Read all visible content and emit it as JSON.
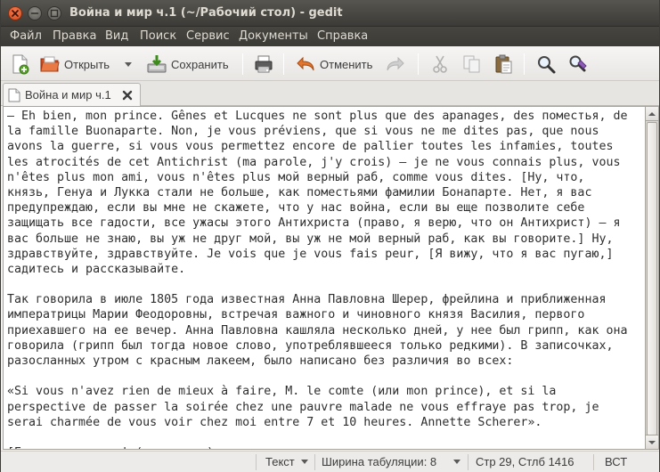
{
  "window": {
    "title": "Война и мир ч.1 (~/Рабочий стол) - gedit"
  },
  "menu": [
    {
      "label": "Файл"
    },
    {
      "label": "Правка"
    },
    {
      "label": "Вид"
    },
    {
      "label": "Поиск"
    },
    {
      "label": "Сервис"
    },
    {
      "label": "Документы"
    },
    {
      "label": "Справка"
    }
  ],
  "toolbar": {
    "new_icon": "new-document-icon",
    "open_label": "Открыть",
    "save_label": "Сохранить",
    "print_icon": "printer-icon",
    "undo_label": "Отменить",
    "redo_icon": "redo-icon",
    "cut_icon": "scissors-icon",
    "copy_icon": "copy-icon",
    "paste_icon": "paste-icon",
    "find_icon": "magnifier-icon",
    "replace_icon": "find-replace-icon"
  },
  "tab": {
    "label": "Война и мир ч.1"
  },
  "document": {
    "lines": [
      "— Eh bien, mon prince. Gênes et Lucques ne sont plus que des apanages, des поместья, de",
      "la famille Buonaparte. Non, je vous préviens, que si vous ne me dites pas, que nous",
      "avons la guerre, si vous vous permettez encore de pallier toutes les infamies, toutes",
      "les atrocités de cet Antichrist (ma parole, j'y crois) — je ne vous connais plus, vous",
      "n'êtes plus mon ami, vous n'êtes plus мой верный раб, comme vous dites. [Ну, что,",
      "князь, Генуа и Лукка стали не больше, как поместьями фамилии Бонапарте. Нет, я вас",
      "предупреждаю, если вы мне не скажете, что у нас война, если вы еще позволите себе",
      "защищать все гадости, все ужасы этого Антихриста (право, я верю, что он Антихрист) — я",
      "вас больше не знаю, вы уж не друг мой, вы уж не мой верный раб, как вы говорите.] Ну,",
      "здравствуйте, здравствуйте. Je vois que je vous fais peur, [Я вижу, что я вас пугаю,]",
      "садитесь и рассказывайте.",
      "",
      "Так говорила в июле 1805 года известная Анна Павловна Шерер, фрейлина и приближенная",
      "императрицы Марии Феодоровны, встречая важного и чиновного князя Василия, первого",
      "приехавшего на ее вечер. Анна Павловна кашляла несколько дней, у нее был грипп, как она",
      "говорила (грипп был тогда новое слово, употреблявшееся только редкими). В записочках,",
      "разосланных утром с красным лакеем, было написано без различия во всех:",
      "",
      "«Si vous n'avez rien de mieux à faire, M. le comte (или mon prince), et si la",
      "perspective de passer la soirée chez une pauvre malade ne vous effraye pas trop, je",
      "serai charmée de vous voir chez moi entre 7 et 10 heures. Annette Scherer».",
      "",
      "[Если у вас, граф (или князь), нет в виду ничего лучшего и если перспектива вечера у"
    ]
  },
  "status": {
    "mode_label": "Текст",
    "tab_width_label": "Ширина табуляции: 8",
    "position": "Стр 29, Стлб 1416",
    "insert_mode": "ВСТ"
  }
}
